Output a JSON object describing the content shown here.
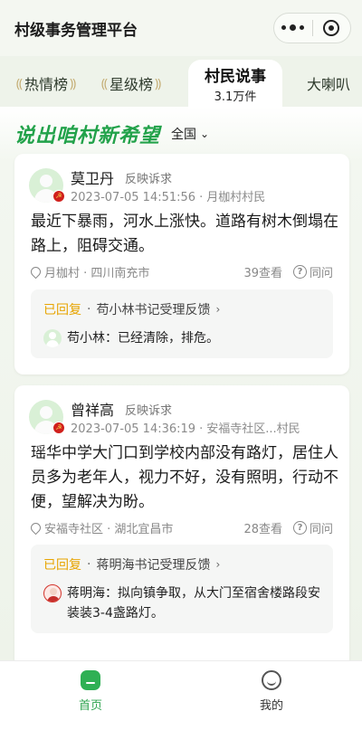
{
  "app": {
    "title": "村级事务管理平台"
  },
  "tabs": [
    {
      "label": "热情榜",
      "sub": ""
    },
    {
      "label": "星级榜",
      "sub": ""
    },
    {
      "label": "村民说事",
      "sub": "3.1万件"
    },
    {
      "label": "大喇叭",
      "sub": ""
    }
  ],
  "headline": {
    "text": "说出咱村新希望",
    "region": "全国"
  },
  "posts": [
    {
      "name": "莫卫丹",
      "type": "反映诉求",
      "time": "2023-07-05 14:51:56",
      "village": "月枷村村民",
      "content": "最近下暴雨，河水上涨快。道路有树木倒塌在路上，阻碍交通。",
      "location": "月枷村 · 四川南充市",
      "views": "39查看",
      "agree": "同问",
      "reply_status": "已回复",
      "reply_handler": "苟小林书记受理反馈",
      "reply_author": "苟小林：",
      "reply_text": "已经清除，排危。"
    },
    {
      "name": "曾祥高",
      "type": "反映诉求",
      "time": "2023-07-05 14:36:19",
      "village": "安福寺社区...村民",
      "content": "瑶华中学大门口到学校内部没有路灯，居住人员多为老年人，视力不好，没有照明，行动不便，望解决为盼。",
      "location": "安福寺社区 · 湖北宜昌市",
      "views": "28查看",
      "agree": "同问",
      "reply_status": "已回复",
      "reply_handler": "蒋明海书记受理反馈",
      "reply_author": "蒋明海：",
      "reply_text": "拟向镇争取，从大门至宿舍楼路段安装装3-4盏路灯。"
    }
  ],
  "bottom_nav": [
    {
      "label": "首页",
      "icon": "home-icon",
      "active": true
    },
    {
      "label": "我的",
      "icon": "smiley-icon",
      "active": false
    }
  ],
  "colors": {
    "accent": "#2fb054",
    "replied": "#e7a400",
    "party_red": "#d0201c"
  }
}
